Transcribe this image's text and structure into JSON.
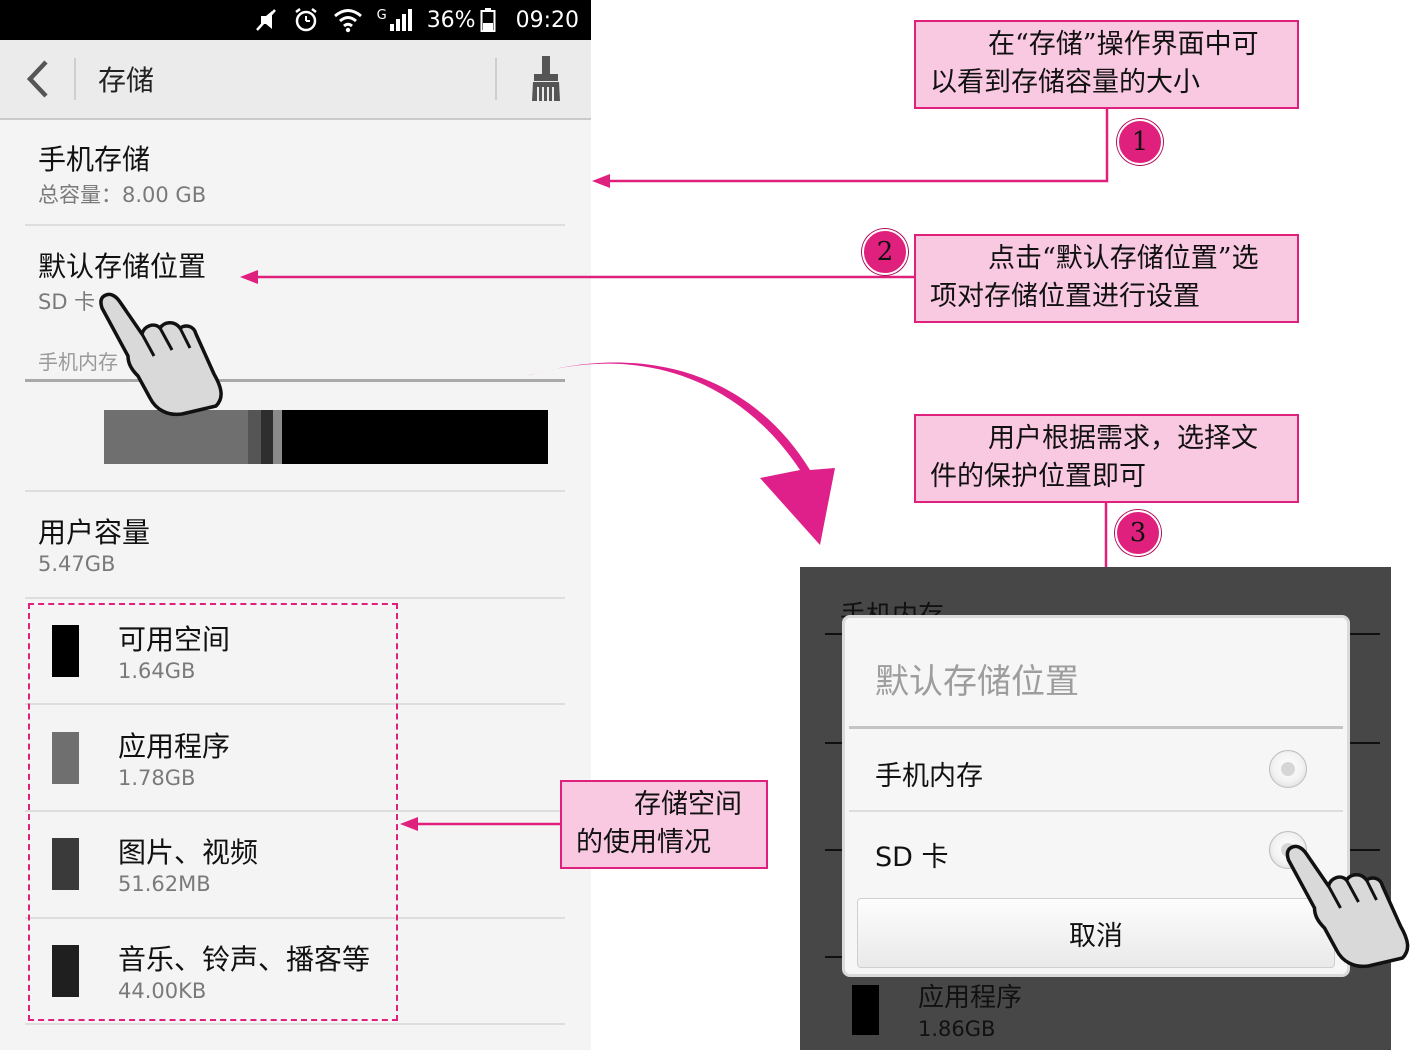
{
  "status_bar": {
    "battery": "36%",
    "network": "G",
    "time": "09:20"
  },
  "action_bar": {
    "title": "存储"
  },
  "storage": {
    "phone_storage": {
      "title": "手机存储",
      "total": "总容量：8.00 GB"
    },
    "default_location": {
      "title": "默认存储位置",
      "value": "SD 卡"
    },
    "section_label": "手机内存",
    "usage_bar": [
      {
        "color": "#6f6f6f",
        "share": 0.325
      },
      {
        "color": "#555555",
        "share": 0.028
      },
      {
        "color": "#2e2e2e",
        "share": 0.027
      },
      {
        "color": "#8a8a8a",
        "share": 0.02
      },
      {
        "color": "#000000",
        "share": 0.6
      }
    ],
    "user_capacity": {
      "title": "用户容量",
      "value": "5.47GB"
    },
    "legend": [
      {
        "label": "可用空间",
        "size": "1.64GB",
        "color": "#000000"
      },
      {
        "label": "应用程序",
        "size": "1.78GB",
        "color": "#6f6f6f"
      },
      {
        "label": "图片、视频",
        "size": "51.62MB",
        "color": "#3a3a3a"
      },
      {
        "label": "音乐、铃声、播客等",
        "size": "44.00KB",
        "color": "#1f1f1f"
      }
    ]
  },
  "callouts": {
    "c1": {
      "line1": "在“存储”操作界面中可",
      "line2": "以看到存储容量的大小",
      "num": "1"
    },
    "c2": {
      "line1": "点击“默认存储位置”选",
      "line2": "项对存储位置进行设置",
      "num": "2"
    },
    "c3": {
      "line1": "用户根据需求，选择文",
      "line2": "件的保护位置即可",
      "num": "3"
    },
    "c4": {
      "line1": "存储空间",
      "line2": "的使用情况"
    }
  },
  "dialog": {
    "background_label_top": "手机内存",
    "background_label_bottom": "应用程序",
    "background_value_bottom": "1.86GB",
    "title": "默认存储位置",
    "options": [
      "手机内存",
      "SD 卡"
    ],
    "cancel": "取消"
  },
  "colors": {
    "accent": "#e0207d",
    "callout_fill": "#f9c9e2"
  }
}
